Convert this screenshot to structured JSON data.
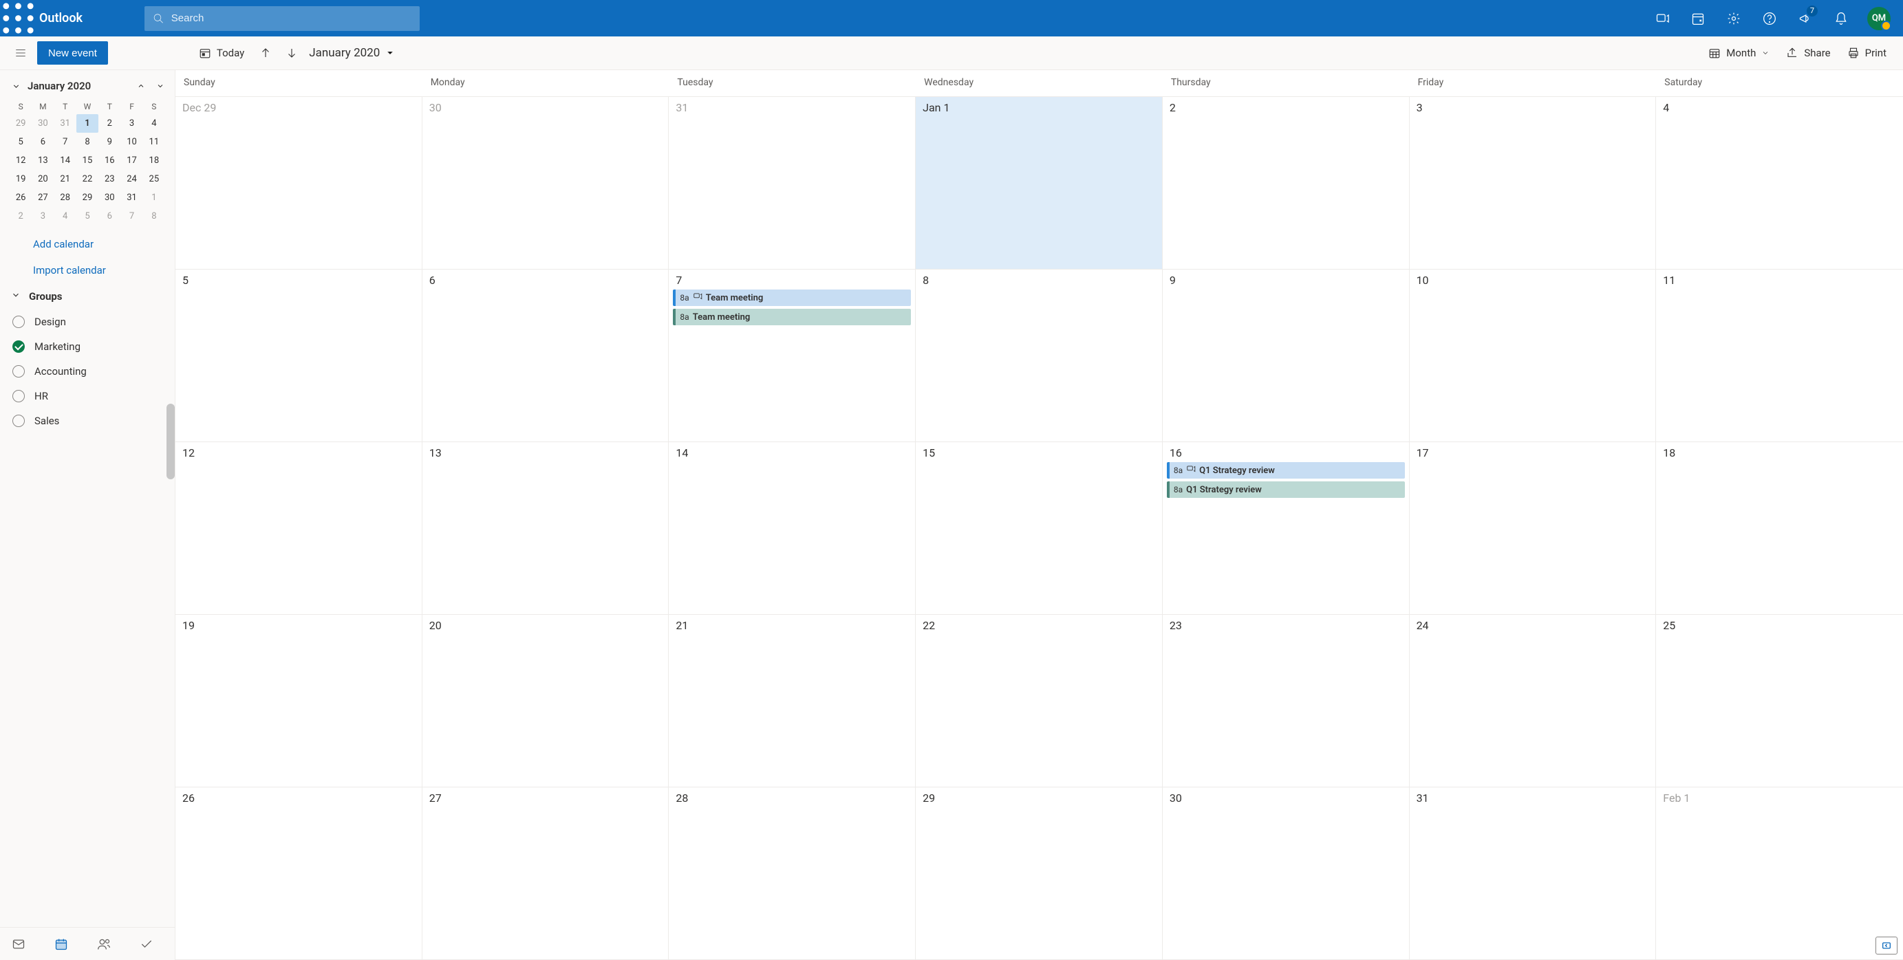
{
  "suite": {
    "app_name": "Outlook",
    "search_placeholder": "Search",
    "whats_new_badge": "7",
    "avatar_initials": "QM"
  },
  "cmd": {
    "new_event": "New event",
    "today": "Today",
    "month_label": "January 2020",
    "view": "Month",
    "share": "Share",
    "print": "Print"
  },
  "mini_cal": {
    "title": "January 2020",
    "dow": [
      "S",
      "M",
      "T",
      "W",
      "T",
      "F",
      "S"
    ],
    "rows": [
      [
        {
          "n": "29",
          "m": true
        },
        {
          "n": "30",
          "m": true
        },
        {
          "n": "31",
          "m": true
        },
        {
          "n": "1",
          "sel": true
        },
        {
          "n": "2"
        },
        {
          "n": "3"
        },
        {
          "n": "4"
        }
      ],
      [
        {
          "n": "5"
        },
        {
          "n": "6"
        },
        {
          "n": "7"
        },
        {
          "n": "8"
        },
        {
          "n": "9"
        },
        {
          "n": "10"
        },
        {
          "n": "11"
        }
      ],
      [
        {
          "n": "12"
        },
        {
          "n": "13"
        },
        {
          "n": "14"
        },
        {
          "n": "15"
        },
        {
          "n": "16"
        },
        {
          "n": "17"
        },
        {
          "n": "18"
        }
      ],
      [
        {
          "n": "19"
        },
        {
          "n": "20"
        },
        {
          "n": "21"
        },
        {
          "n": "22"
        },
        {
          "n": "23"
        },
        {
          "n": "24"
        },
        {
          "n": "25"
        }
      ],
      [
        {
          "n": "26"
        },
        {
          "n": "27"
        },
        {
          "n": "28"
        },
        {
          "n": "29"
        },
        {
          "n": "30"
        },
        {
          "n": "31"
        },
        {
          "n": "1",
          "m": true
        }
      ],
      [
        {
          "n": "2",
          "m": true
        },
        {
          "n": "3",
          "m": true
        },
        {
          "n": "4",
          "m": true
        },
        {
          "n": "5",
          "m": true
        },
        {
          "n": "6",
          "m": true
        },
        {
          "n": "7",
          "m": true
        },
        {
          "n": "8",
          "m": true
        }
      ]
    ]
  },
  "sidebar": {
    "add_calendar": "Add calendar",
    "import_calendar": "Import calendar",
    "groups_label": "Groups",
    "groups": [
      {
        "label": "Design",
        "checked": false
      },
      {
        "label": "Marketing",
        "checked": true
      },
      {
        "label": "Accounting",
        "checked": false
      },
      {
        "label": "HR",
        "checked": false
      },
      {
        "label": "Sales",
        "checked": false
      }
    ]
  },
  "grid": {
    "dow": [
      "Sunday",
      "Monday",
      "Tuesday",
      "Wednesday",
      "Thursday",
      "Friday",
      "Saturday"
    ],
    "weeks": [
      [
        {
          "label": "Dec 29",
          "muted": true
        },
        {
          "label": "30",
          "muted": true
        },
        {
          "label": "31",
          "muted": true
        },
        {
          "label": "Jan 1",
          "today": true
        },
        {
          "label": "2"
        },
        {
          "label": "3"
        },
        {
          "label": "4"
        }
      ],
      [
        {
          "label": "5"
        },
        {
          "label": "6"
        },
        {
          "label": "7",
          "events": [
            {
              "time": "8a",
              "title": "Team meeting",
              "icon": true,
              "color": "blue",
              "bold": true
            },
            {
              "time": "8a",
              "title": "Team meeting",
              "icon": false,
              "color": "teal",
              "bold": true
            }
          ]
        },
        {
          "label": "8"
        },
        {
          "label": "9"
        },
        {
          "label": "10"
        },
        {
          "label": "11"
        }
      ],
      [
        {
          "label": "12"
        },
        {
          "label": "13"
        },
        {
          "label": "14"
        },
        {
          "label": "15"
        },
        {
          "label": "16",
          "events": [
            {
              "time": "8a",
              "title": "Q1 Strategy review",
              "icon": true,
              "color": "blue",
              "bold": true
            },
            {
              "time": "8a",
              "title": "Q1 Strategy review",
              "icon": false,
              "color": "teal",
              "bold": true
            }
          ]
        },
        {
          "label": "17"
        },
        {
          "label": "18"
        }
      ],
      [
        {
          "label": "19"
        },
        {
          "label": "20"
        },
        {
          "label": "21"
        },
        {
          "label": "22"
        },
        {
          "label": "23"
        },
        {
          "label": "24"
        },
        {
          "label": "25"
        }
      ],
      [
        {
          "label": "26"
        },
        {
          "label": "27"
        },
        {
          "label": "28"
        },
        {
          "label": "29"
        },
        {
          "label": "30"
        },
        {
          "label": "31"
        },
        {
          "label": "Feb 1",
          "muted": true
        }
      ]
    ]
  }
}
